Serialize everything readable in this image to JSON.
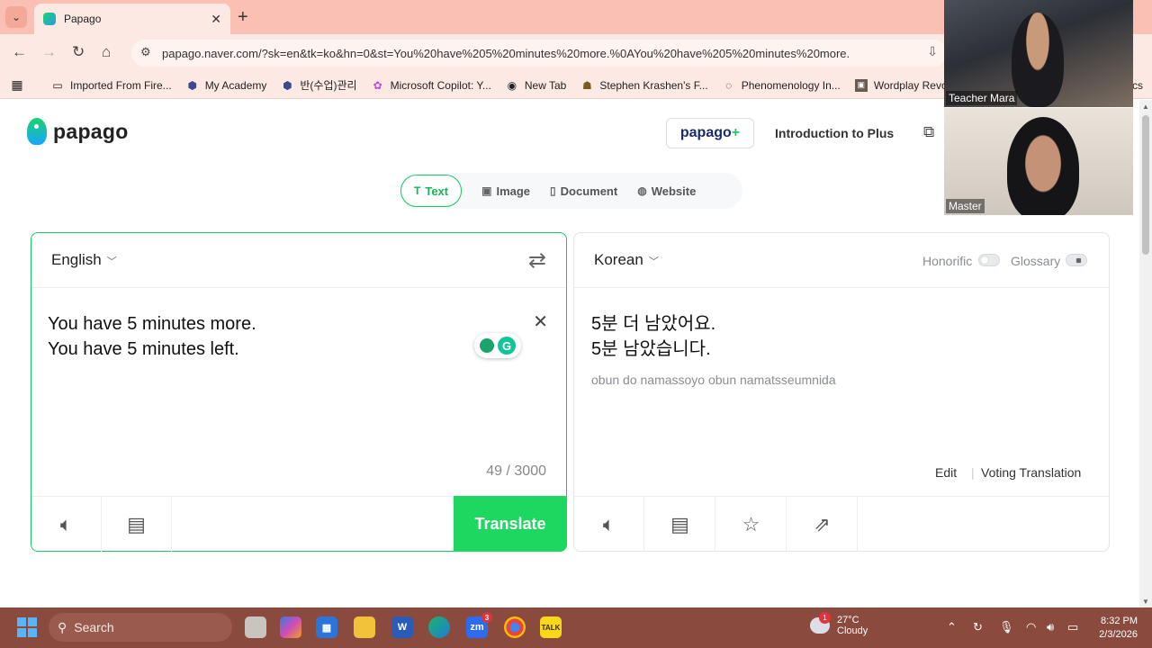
{
  "browser": {
    "tab_title": "Papago",
    "url": "papago.naver.com/?sk=en&tk=ko&hn=0&st=You%20have%205%20minutes%20more.%0AYou%20have%205%20minutes%20more.",
    "bookmarks": [
      {
        "label": "Imported From Fire...",
        "icon": "folder-icon"
      },
      {
        "label": "My Academy",
        "icon": "shield-icon"
      },
      {
        "label": "반(수업)관리",
        "icon": "shield-icon"
      },
      {
        "label": "Microsoft Copilot: Y...",
        "icon": "copilot-icon"
      },
      {
        "label": "New Tab",
        "icon": "globe-icon"
      },
      {
        "label": "Stephen Krashen's F...",
        "icon": "site-icon"
      },
      {
        "label": "Phenomenology In...",
        "icon": "site-icon"
      },
      {
        "label": "Wordplay Revolutio...",
        "icon": "image-icon"
      }
    ],
    "bookmarks_overflow": "cs"
  },
  "papago": {
    "logo_text": "papago",
    "plus_button": {
      "main": "papago",
      "plus": "+"
    },
    "intro_link": "Introduction to Plus",
    "modes": [
      {
        "label": "Text",
        "icon": "T",
        "active": true
      },
      {
        "label": "Image",
        "icon": "▣",
        "active": false
      },
      {
        "label": "Document",
        "icon": "▯",
        "active": false
      },
      {
        "label": "Website",
        "icon": "◍",
        "active": false
      }
    ],
    "source": {
      "language": "English",
      "text": "You have 5 minutes more.\nYou have 5 minutes left.",
      "char_count": "49 / 3000",
      "translate_button": "Translate"
    },
    "target": {
      "language": "Korean",
      "honorific_label": "Honorific",
      "glossary_label": "Glossary",
      "text": "5분 더 남았어요.\n5분 남았습니다.",
      "romanization": "obun do namassoyo obun namatsseumnida",
      "edit_link": "Edit",
      "separator": "|",
      "voting_link": "Voting Translation"
    },
    "colors": {
      "accent": "#1ed760",
      "brand_text": "#1a2a6b"
    }
  },
  "video": {
    "participants": [
      "Teacher Mara",
      "Master"
    ]
  },
  "taskbar": {
    "search_placeholder": "Search",
    "weather": {
      "temp": "27°C",
      "condition": "Cloudy",
      "badge": "1"
    },
    "zoom_badge": "3",
    "time": "8:32 PM",
    "date": "2/3/2026"
  }
}
